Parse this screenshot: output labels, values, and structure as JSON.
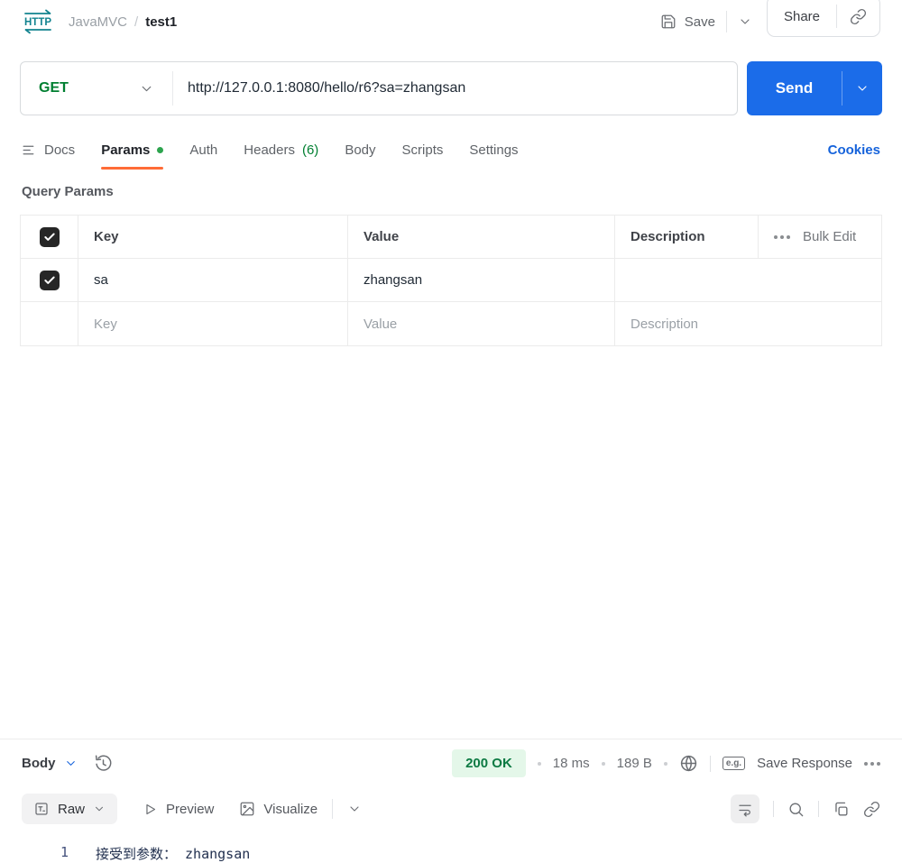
{
  "header": {
    "logo_text": "HTTP",
    "breadcrumb": {
      "project": "JavaMVC",
      "separator": "/",
      "current": "test1"
    },
    "save_label": "Save",
    "share_label": "Share"
  },
  "request": {
    "method": "GET",
    "url": "http://127.0.0.1:8080/hello/r6?sa=zhangsan",
    "send_label": "Send"
  },
  "tabs": {
    "items": [
      {
        "label": "Docs"
      },
      {
        "label": "Params"
      },
      {
        "label": "Auth"
      },
      {
        "label": "Headers",
        "count": "(6)"
      },
      {
        "label": "Body"
      },
      {
        "label": "Scripts"
      },
      {
        "label": "Settings"
      }
    ],
    "cookies_label": "Cookies"
  },
  "query_params": {
    "title": "Query Params",
    "columns": {
      "key": "Key",
      "value": "Value",
      "description": "Description"
    },
    "bulk_edit_label": "Bulk Edit",
    "rows": [
      {
        "key": "sa",
        "value": "zhangsan",
        "description": ""
      }
    ],
    "placeholders": {
      "key": "Key",
      "value": "Value",
      "description": "Description"
    }
  },
  "response": {
    "body_label": "Body",
    "status": "200 OK",
    "time": "18 ms",
    "size": "189 B",
    "eg_badge": "e.g.",
    "save_response_label": "Save Response",
    "view_tabs": {
      "raw": "Raw",
      "preview": "Preview",
      "visualize": "Visualize"
    },
    "content": {
      "line_number": "1",
      "text": "接受到参数： zhangsan"
    }
  },
  "colors": {
    "logo_teal": "#12838f",
    "method_green": "#007f31",
    "accent_orange": "#ff6c37",
    "send_blue": "#1b6ce9",
    "link_blue": "#1663db",
    "status_green_text": "#0c7a43",
    "status_green_bg": "#e4f7e9"
  }
}
